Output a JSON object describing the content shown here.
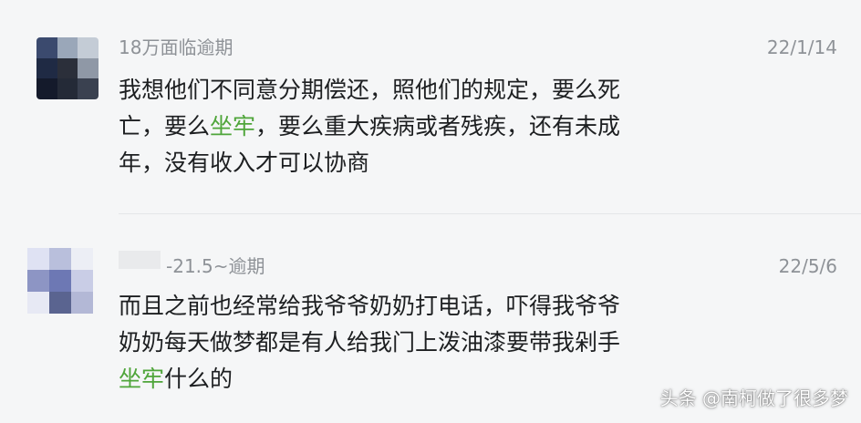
{
  "comments": [
    {
      "author": "18万面临逾期",
      "date": "22/1/14",
      "body_lines": [
        [
          {
            "t": "我想他们不同意分期偿还，照他们的规定，要么死"
          }
        ],
        [
          {
            "t": "亡，要么"
          },
          {
            "t": "坐牢",
            "highlight": true
          },
          {
            "t": "，要么重大疾病或者残疾，还有未成"
          }
        ],
        [
          {
            "t": "年，没有收入才可以协商"
          }
        ]
      ]
    },
    {
      "author": "-21.5~逾期",
      "date": "22/5/6",
      "body_lines": [
        [
          {
            "t": "而且之前也经常给我爷爷奶奶打电话，吓得我爷爷"
          }
        ],
        [
          {
            "t": "奶奶每天做梦都是有人给我门上泼油漆要带我剁手"
          }
        ],
        [
          {
            "t": "坐牢",
            "highlight": true
          },
          {
            "t": "什么的"
          }
        ]
      ]
    }
  ],
  "watermark": "头条 @南柯做了很多梦",
  "colors": {
    "background": "#f5f6f7",
    "meta_text": "#8e9297",
    "body_text": "#1d1f21",
    "highlight": "#4fa53a"
  },
  "icons": {
    "avatar_1": "blurred-avatar",
    "avatar_2": "blurred-avatar"
  }
}
